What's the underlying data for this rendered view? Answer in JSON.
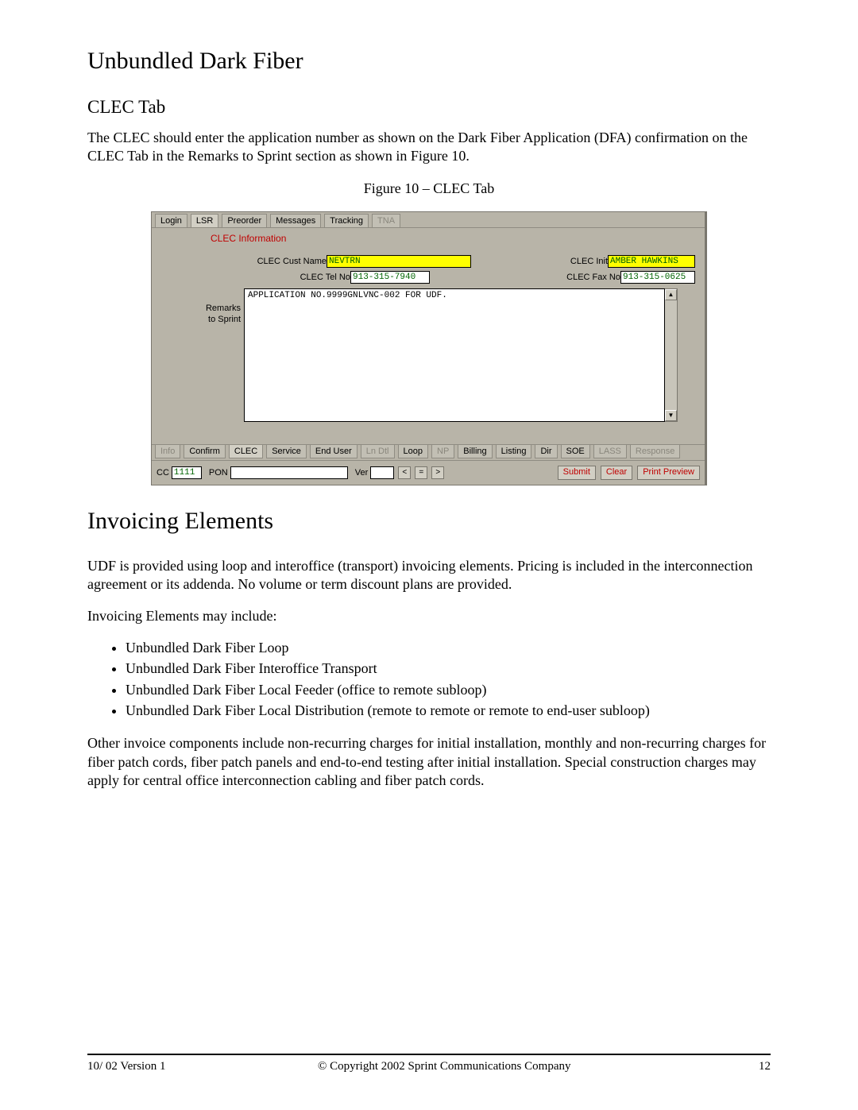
{
  "headings": {
    "h1_udf": "Unbundled Dark Fiber",
    "h2_clec": "CLEC Tab",
    "h1_invoicing": "Invoicing Elements"
  },
  "paragraphs": {
    "clec_intro": "The CLEC should enter the application number as shown on the Dark Fiber Application (DFA) confirmation on the CLEC Tab in the Remarks to Sprint section as shown in Figure 10.",
    "invoicing_intro": "UDF is provided using loop and interoffice (transport) invoicing elements. Pricing is included in the interconnection agreement or its addenda. No volume or term discount plans are provided.",
    "invoicing_may_include": "Invoicing Elements may include:",
    "invoicing_other": "Other invoice components include non-recurring charges for initial installation, monthly and non-recurring charges for fiber patch cords, fiber patch panels and end-to-end testing after initial installation. Special construction charges may apply for central office interconnection cabling and fiber patch cords."
  },
  "figure_caption": "Figure 10 – CLEC Tab",
  "app": {
    "top_tabs": [
      {
        "label": "Login",
        "active": false,
        "disabled": false
      },
      {
        "label": "LSR",
        "active": true,
        "disabled": false
      },
      {
        "label": "Preorder",
        "active": false,
        "disabled": false
      },
      {
        "label": "Messages",
        "active": false,
        "disabled": false
      },
      {
        "label": "Tracking",
        "active": false,
        "disabled": false
      },
      {
        "label": "TNA",
        "active": false,
        "disabled": true
      }
    ],
    "panel_title": "CLEC Information",
    "fields": {
      "clec_cust_name_label": "CLEC Cust Name",
      "clec_cust_name_value": "NEVTRN",
      "clec_tel_no_label": "CLEC Tel No",
      "clec_tel_no_value": "913-315-7940",
      "clec_init_label": "CLEC Init",
      "clec_init_value": "AMBER HAWKINS",
      "clec_fax_no_label": "CLEC Fax No",
      "clec_fax_no_value": "913-315-0625",
      "remarks_label_line1": "Remarks",
      "remarks_label_line2": "to Sprint",
      "remarks_value": "APPLICATION NO.9999GNLVNC-002 FOR UDF."
    },
    "bottom_tabs": [
      {
        "label": "Info",
        "disabled": true,
        "active": false
      },
      {
        "label": "Confirm",
        "disabled": false,
        "active": false
      },
      {
        "label": "CLEC",
        "disabled": false,
        "active": true
      },
      {
        "label": "Service",
        "disabled": false,
        "active": false
      },
      {
        "label": "End User",
        "disabled": false,
        "active": false
      },
      {
        "label": "Ln Dtl",
        "disabled": true,
        "active": false
      },
      {
        "label": "Loop",
        "disabled": false,
        "active": false
      },
      {
        "label": "NP",
        "disabled": true,
        "active": false
      },
      {
        "label": "Billing",
        "disabled": false,
        "active": false
      },
      {
        "label": "Listing",
        "disabled": false,
        "active": false
      },
      {
        "label": "Dir",
        "disabled": false,
        "active": false
      },
      {
        "label": "SOE",
        "disabled": false,
        "active": false
      },
      {
        "label": "LASS",
        "disabled": true,
        "active": false
      },
      {
        "label": "Response",
        "disabled": true,
        "active": false
      }
    ],
    "status": {
      "cc_label": "CC",
      "cc_value": "1111",
      "pon_label": "PON",
      "pon_value": "",
      "ver_label": "Ver",
      "ver_value": "",
      "nav_prev": "<",
      "nav_eq": "=",
      "nav_next": ">",
      "submit": "Submit",
      "clear": "Clear",
      "print_preview": "Print Preview"
    }
  },
  "invoicing_items": [
    "Unbundled Dark Fiber Loop",
    "Unbundled Dark Fiber Interoffice Transport",
    "Unbundled Dark Fiber Local Feeder (office to remote subloop)",
    "Unbundled Dark Fiber Local Distribution (remote to remote or remote to end-user subloop)"
  ],
  "footer": {
    "left": "10/ 02 Version 1",
    "center": "© Copyright 2002 Sprint Communications Company",
    "page_number": "12"
  }
}
